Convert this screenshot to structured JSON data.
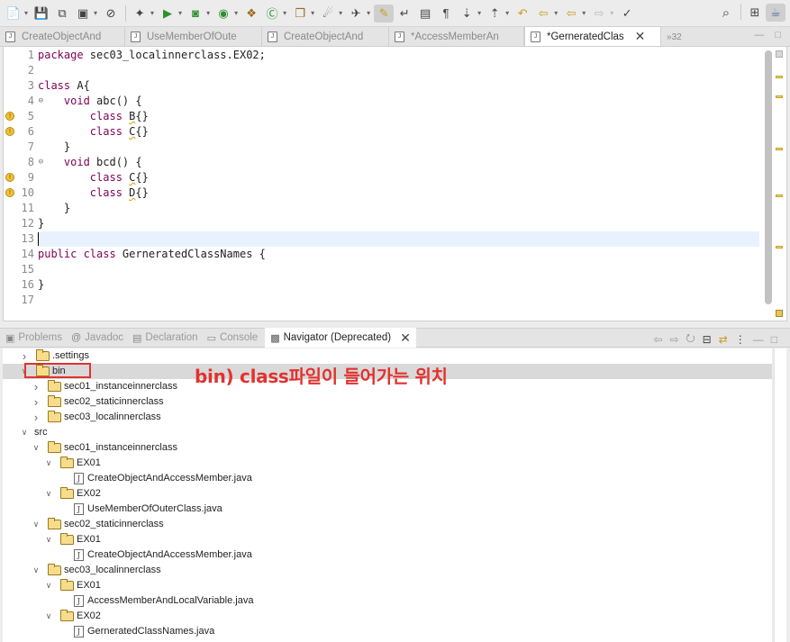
{
  "toolbar": {
    "buttons": [
      "new-icon",
      "save-icon",
      "save-all-icon",
      "terminal-icon",
      "skip-breakpoints-icon",
      "debug-icon",
      "run-icon",
      "coverage-icon",
      "external-tools-icon",
      "new-java-project-icon",
      "new-class-icon",
      "open-type-icon",
      "search-icon-tb",
      "next-annotation-icon",
      "toggle-mark-occurrences-icon",
      "word-wrap-icon",
      "block-selection-icon",
      "show-whitespace-icon",
      "next-edit-icon",
      "prev-edit-icon",
      "last-edit-icon",
      "back-icon",
      "forward-icon",
      "pin-editor-icon"
    ],
    "right": [
      "quick-search-icon",
      "open-perspective-icon",
      "java-perspective-icon"
    ]
  },
  "editor_tabs": [
    {
      "label": "CreateObjectAnd",
      "active": false
    },
    {
      "label": "UseMemberOfOute",
      "active": false
    },
    {
      "label": "CreateObjectAnd",
      "active": false
    },
    {
      "label": "*AccessMemberAn",
      "active": false
    },
    {
      "label": "*GerneratedClas",
      "active": true
    }
  ],
  "editor_overflow": "32",
  "editor": {
    "lines": [
      {
        "n": "1",
        "text": "package sec03_localinnerclass.EX02;",
        "fold": false,
        "warn": false
      },
      {
        "n": "2",
        "text": "",
        "fold": false,
        "warn": false
      },
      {
        "n": "3",
        "text": "class A{",
        "fold": false,
        "warn": false
      },
      {
        "n": "4",
        "text": "    void abc() {",
        "fold": true,
        "warn": false
      },
      {
        "n": "5",
        "text": "        class B{}",
        "fold": false,
        "warn": true
      },
      {
        "n": "6",
        "text": "        class C{}",
        "fold": false,
        "warn": true
      },
      {
        "n": "7",
        "text": "    }",
        "fold": false,
        "warn": false
      },
      {
        "n": "8",
        "text": "    void bcd() {",
        "fold": true,
        "warn": false
      },
      {
        "n": "9",
        "text": "        class C{}",
        "fold": false,
        "warn": true
      },
      {
        "n": "10",
        "text": "        class D{}",
        "fold": false,
        "warn": true
      },
      {
        "n": "11",
        "text": "    }",
        "fold": false,
        "warn": false
      },
      {
        "n": "12",
        "text": "}",
        "fold": false,
        "warn": false
      },
      {
        "n": "13",
        "text": "",
        "fold": false,
        "warn": false
      },
      {
        "n": "14",
        "text": "public class GerneratedClassNames {",
        "fold": false,
        "warn": false
      },
      {
        "n": "15",
        "text": "",
        "fold": false,
        "warn": false
      },
      {
        "n": "16",
        "text": "}",
        "fold": false,
        "warn": false
      },
      {
        "n": "17",
        "text": "",
        "fold": false,
        "warn": false
      }
    ]
  },
  "view_tabs": [
    {
      "label": "Problems",
      "icon": "problems-icon"
    },
    {
      "label": "Javadoc",
      "icon": "javadoc-icon"
    },
    {
      "label": "Declaration",
      "icon": "declaration-icon"
    },
    {
      "label": "Console",
      "icon": "console-icon"
    },
    {
      "label": "Navigator (Deprecated)",
      "icon": "navigator-icon",
      "active": true
    }
  ],
  "navigator": {
    "rows": [
      {
        "label": ".settings",
        "depth": 0,
        "twisty": "closed",
        "type": "folder"
      },
      {
        "label": "bin",
        "depth": 0,
        "twisty": "open",
        "type": "folder",
        "selected": true
      },
      {
        "label": "sec01_instanceinnerclass",
        "depth": 1,
        "twisty": "closed",
        "type": "folder"
      },
      {
        "label": "sec02_staticinnerclass",
        "depth": 1,
        "twisty": "closed",
        "type": "folder"
      },
      {
        "label": "sec03_localinnerclass",
        "depth": 1,
        "twisty": "closed",
        "type": "folder"
      },
      {
        "label": "src",
        "depth": 0,
        "twisty": "open",
        "type": "none"
      },
      {
        "label": "sec01_instanceinnerclass",
        "depth": 1,
        "twisty": "open",
        "type": "folder"
      },
      {
        "label": "EX01",
        "depth": 2,
        "twisty": "open",
        "type": "folder"
      },
      {
        "label": "CreateObjectAndAccessMember.java",
        "depth": 3,
        "twisty": "none",
        "type": "java"
      },
      {
        "label": "EX02",
        "depth": 2,
        "twisty": "open",
        "type": "folder"
      },
      {
        "label": "UseMemberOfOuterClass.java",
        "depth": 3,
        "twisty": "none",
        "type": "java"
      },
      {
        "label": "sec02_staticinnerclass",
        "depth": 1,
        "twisty": "open",
        "type": "folder"
      },
      {
        "label": "EX01",
        "depth": 2,
        "twisty": "open",
        "type": "folder"
      },
      {
        "label": "CreateObjectAndAccessMember.java",
        "depth": 3,
        "twisty": "none",
        "type": "java"
      },
      {
        "label": "sec03_localinnerclass",
        "depth": 1,
        "twisty": "open",
        "type": "folder"
      },
      {
        "label": "EX01",
        "depth": 2,
        "twisty": "open",
        "type": "folder"
      },
      {
        "label": "AccessMemberAndLocalVariable.java",
        "depth": 3,
        "twisty": "none",
        "type": "java"
      },
      {
        "label": "EX02",
        "depth": 2,
        "twisty": "open",
        "type": "folder"
      },
      {
        "label": "GerneratedClassNames.java",
        "depth": 3,
        "twisty": "none",
        "type": "java"
      }
    ]
  },
  "annotation": {
    "text": "bin) class파일이 들어가는 위치",
    "color": "#e2322f"
  }
}
